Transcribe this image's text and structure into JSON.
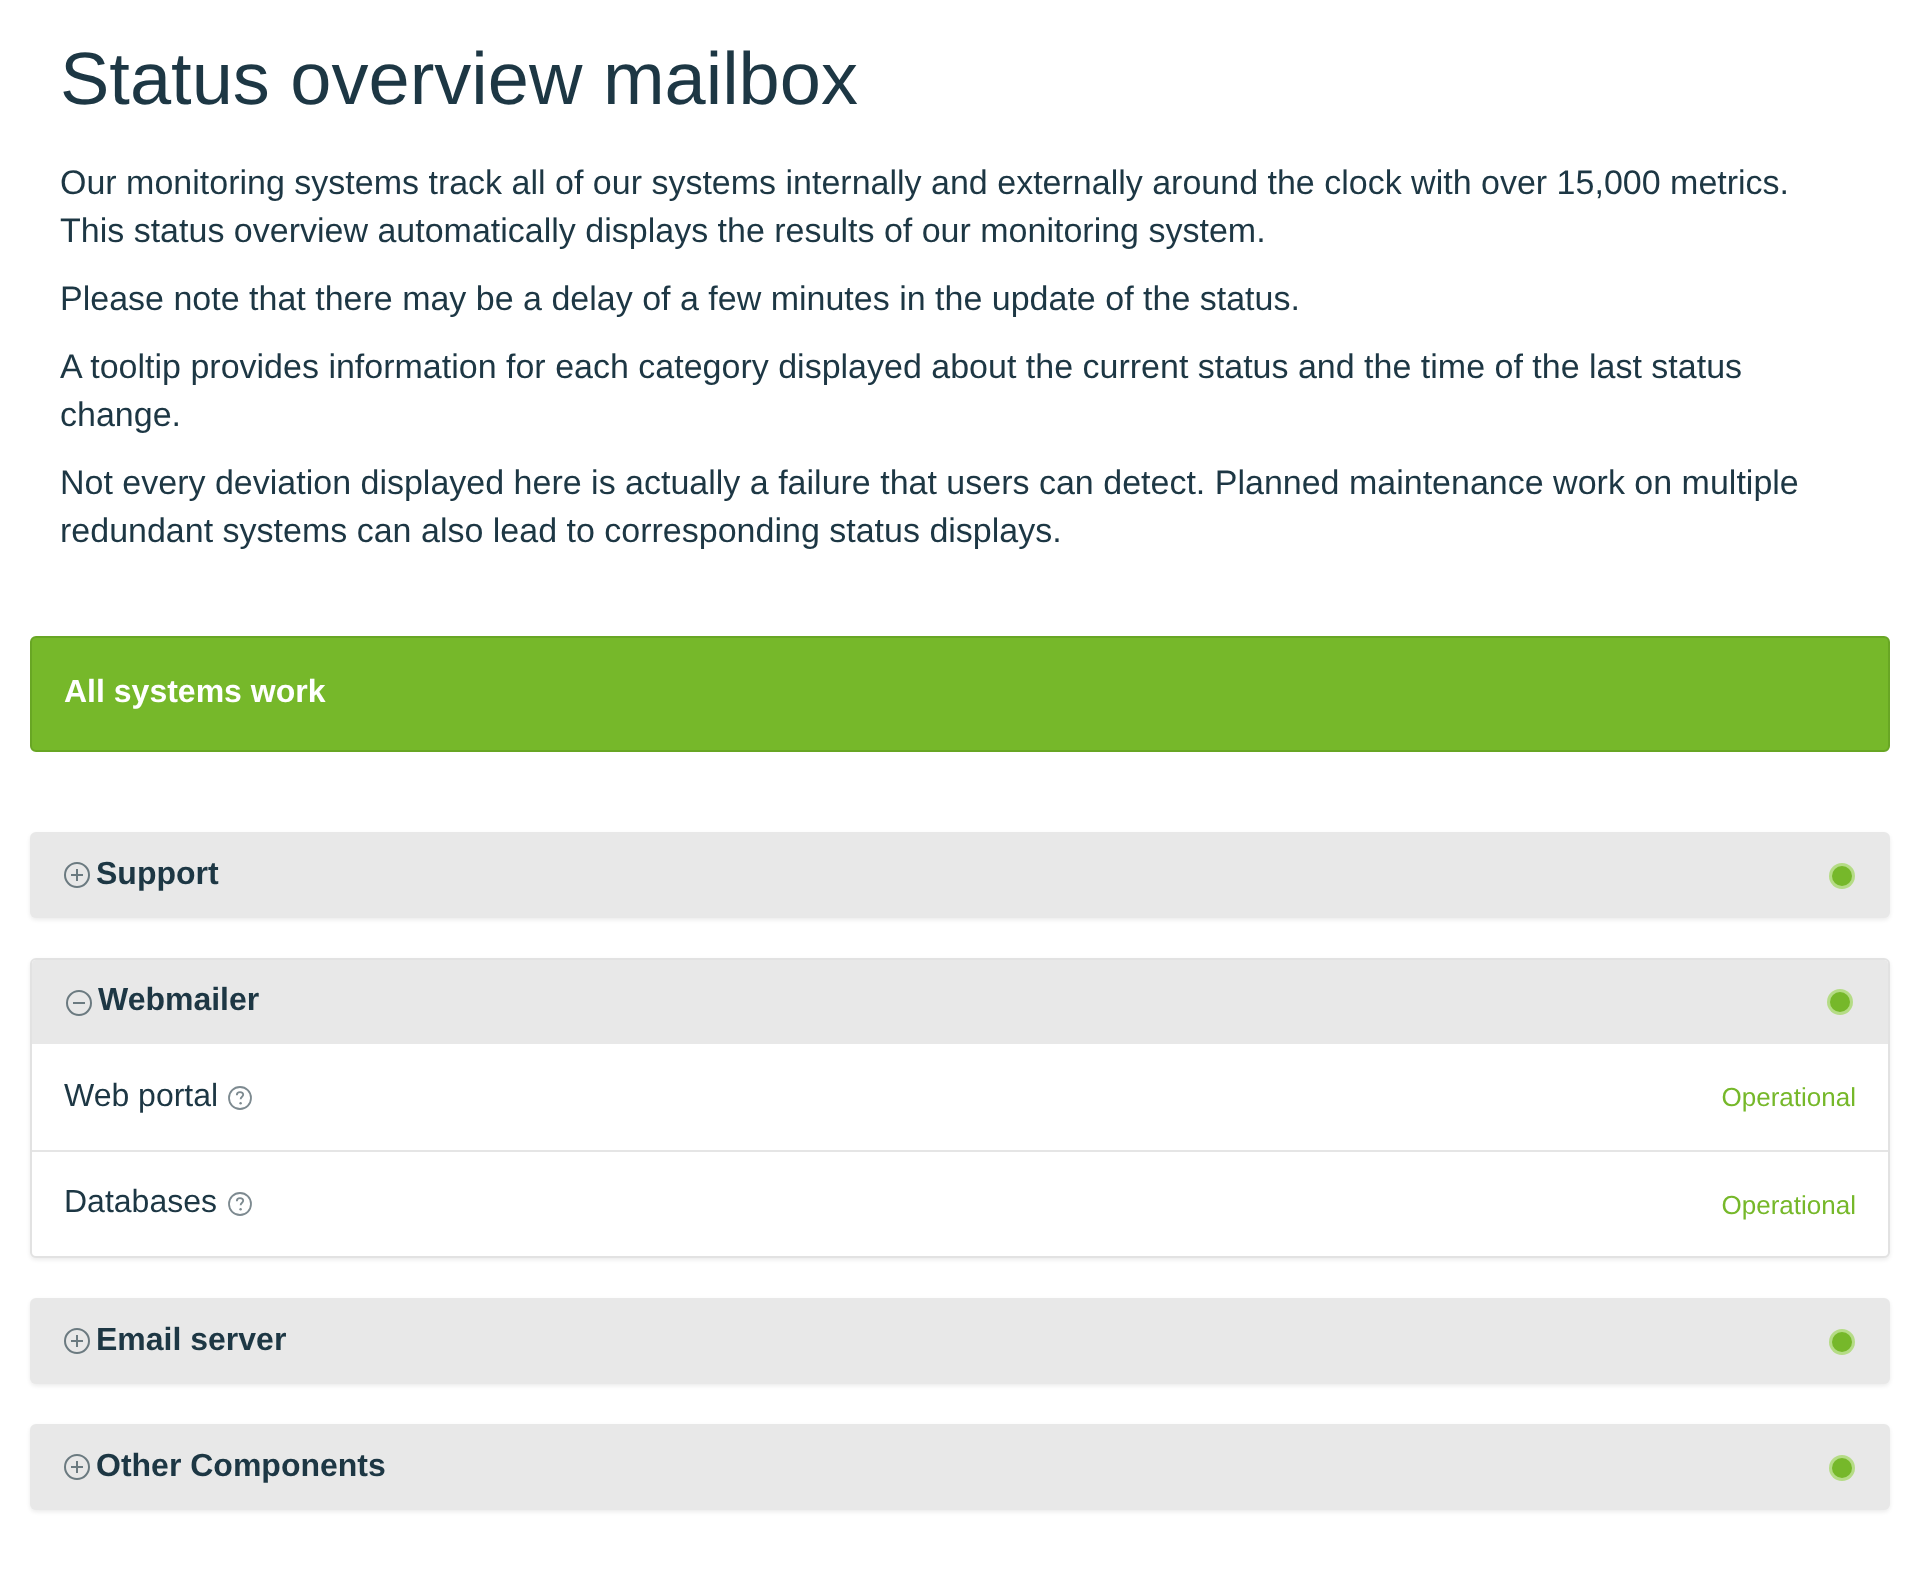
{
  "page": {
    "title": "Status overview mailbox",
    "paragraphs": [
      "Our monitoring systems track all of our systems internally and externally around the clock with over 15,000 metrics. This status overview automatically displays the results of our monitoring system.",
      "Please note that there may be a delay of a few minutes in the update of the status.",
      "A tooltip provides information for each category displayed about the current status and the time of the last status change.",
      "Not every deviation displayed here is actually a failure that users can detect. Planned maintenance work on multiple redundant systems can also lead to corresponding status displays."
    ]
  },
  "banner": {
    "text": "All systems work",
    "operational": true
  },
  "groups": [
    {
      "name": "Support",
      "expanded": false,
      "operational": true
    },
    {
      "name": "Webmailer",
      "expanded": true,
      "operational": true,
      "items": [
        {
          "name": "Web portal",
          "status": "Operational"
        },
        {
          "name": "Databases",
          "status": "Operational"
        }
      ]
    },
    {
      "name": "Email server",
      "expanded": false,
      "operational": true
    },
    {
      "name": "Other Components",
      "expanded": false,
      "operational": true
    }
  ]
}
